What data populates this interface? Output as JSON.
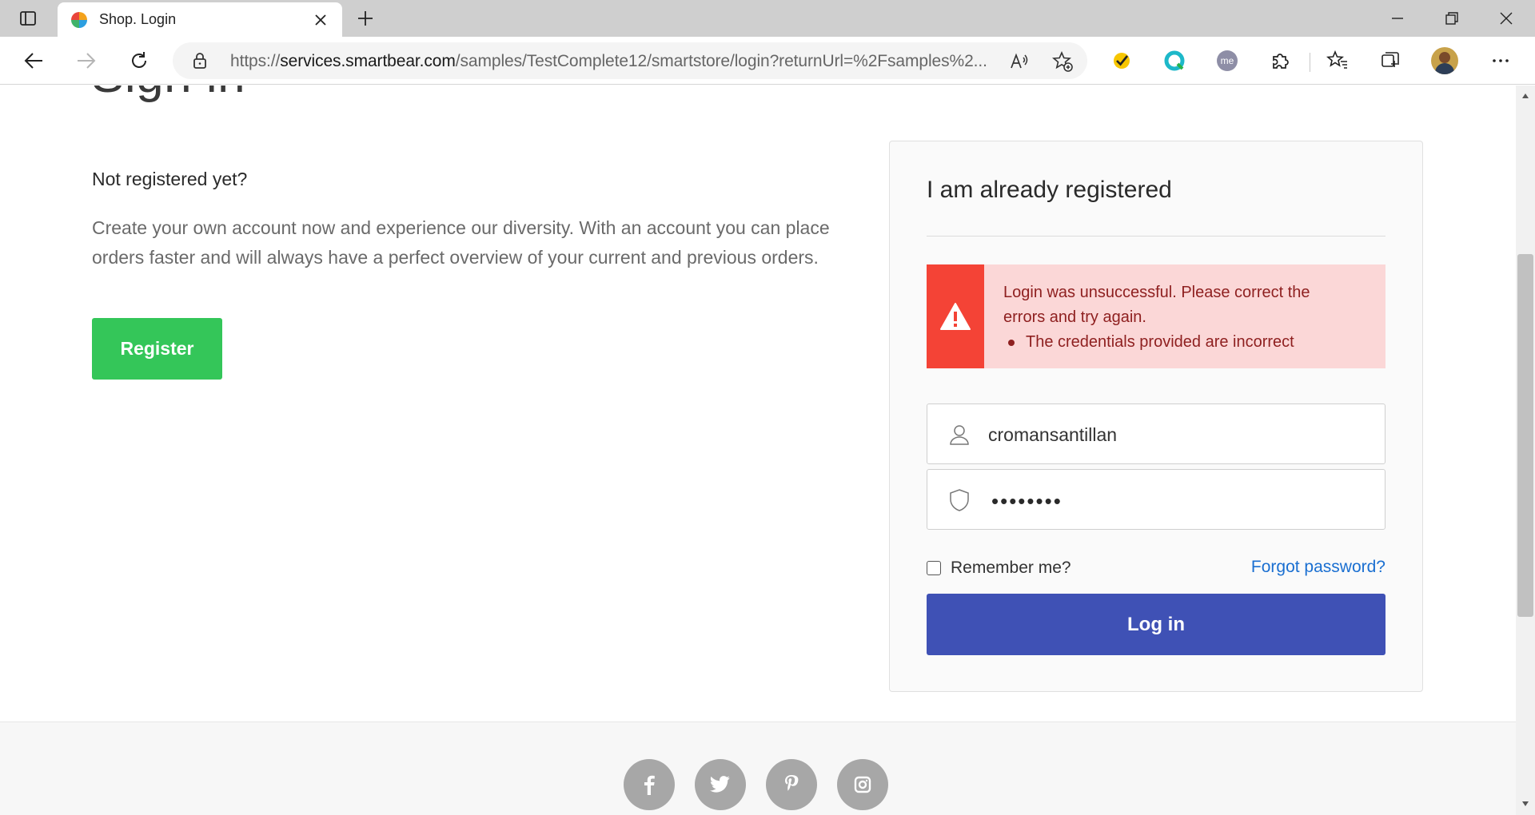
{
  "browser": {
    "tab_title": "Shop. Login",
    "url_scheme": "https://",
    "url_host": "services.smartbear.com",
    "url_rest": "/samples/TestComplete12/smartstore/login?returnUrl=%2Fsamples%2...",
    "profile_color": "#3b3b3b"
  },
  "page": {
    "heading": "Sign in",
    "not_registered": "Not registered yet?",
    "description": "Create your own account now and experience our diversity. With an account you can place orders faster and will always have a perfect overview of your current and previous orders.",
    "register_label": "Register"
  },
  "login": {
    "title": "I am already registered",
    "error_message": "Login was unsuccessful. Please correct the errors and try again.",
    "error_items": [
      "The credentials provided are incorrect"
    ],
    "username_value": "cromansantillan",
    "password_mask": "••••••••",
    "remember_label": "Remember me?",
    "forgot_label": "Forgot password?",
    "login_label": "Log in"
  },
  "footer": {
    "social": [
      "facebook-icon",
      "twitter-icon",
      "pinterest-icon",
      "instagram-icon"
    ]
  },
  "colors": {
    "register_green": "#34c659",
    "login_blue": "#3f51b5",
    "alert_red": "#f44336",
    "alert_bg": "#fbd7d7",
    "link_blue": "#1a6fd1"
  }
}
